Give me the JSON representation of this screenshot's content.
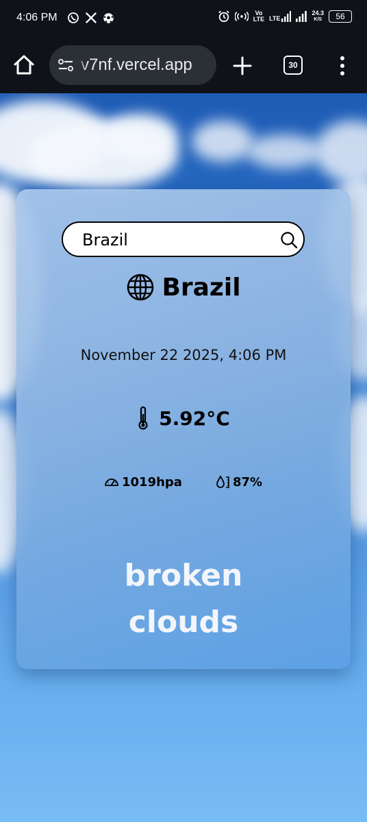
{
  "status_bar": {
    "time": "4:06 PM",
    "left_icons": [
      "whatsapp-icon",
      "x-icon",
      "soccer-ball-icon"
    ],
    "right_icons": [
      "alarm-icon",
      "hotspot-icon",
      "volte-icon",
      "lte-signal-icon",
      "signal-icon"
    ],
    "volte_label": "Vo\nLTE",
    "lte_label": "LTE",
    "net_speed_value": "24.3",
    "net_speed_unit": "K/S",
    "battery_level": "56"
  },
  "browser": {
    "url": "v7nf.vercel.app",
    "tab_count": "30"
  },
  "weather": {
    "search": {
      "value": "Brazil"
    },
    "city": "Brazil",
    "datetime": "November 22 2025, 4:06 PM",
    "temperature": "5.92°C",
    "pressure": "1019hpa",
    "humidity": "87%",
    "description_line1": "broken",
    "description_line2": "clouds"
  },
  "colors": {
    "status_bar_bg": "#0f1319",
    "url_pill_bg": "#2b2f36",
    "sky_top": "#1e5bb5",
    "sky_bottom": "#78bcf6",
    "description_text": "#f2f6fb"
  }
}
